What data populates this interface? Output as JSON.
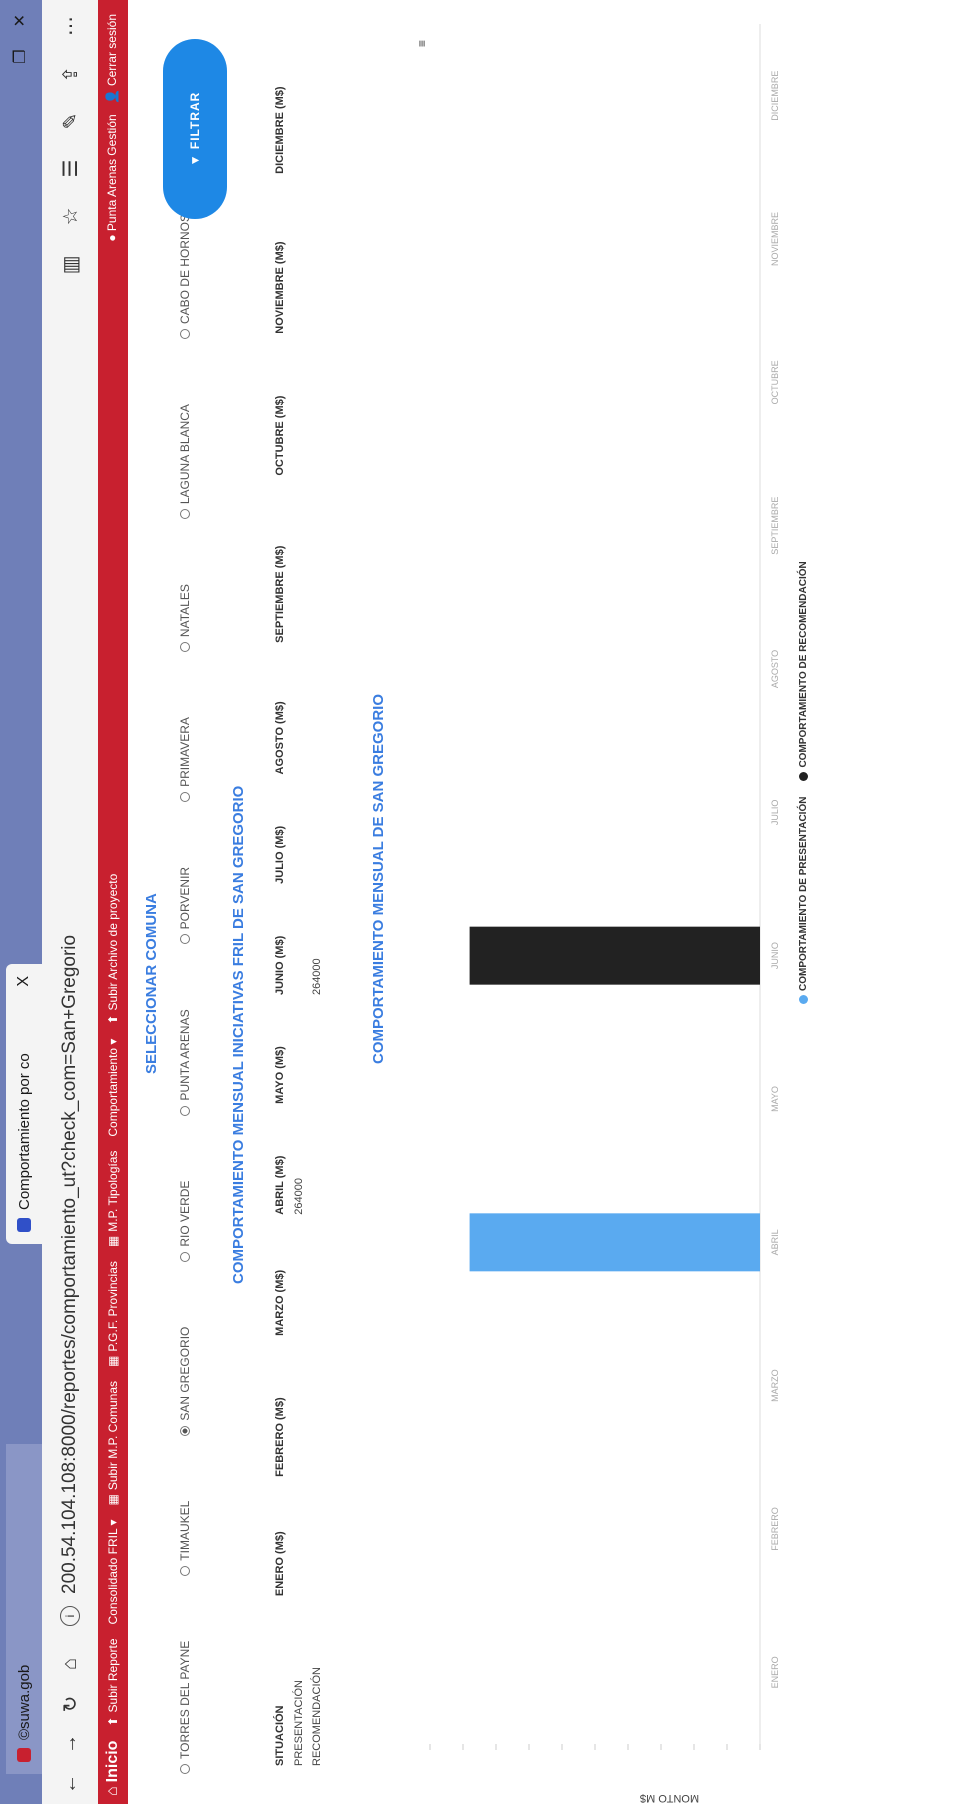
{
  "tabs": [
    {
      "label": "©suwa.gob"
    },
    {
      "label": "Comportamiento por co",
      "close": "X"
    }
  ],
  "address_bar": {
    "url": "200.54.104.108:8000/reportes/comportamiento_ut?check_com=San+Gregorio"
  },
  "app_nav": {
    "items": [
      "Inicio",
      "Subir Reporte",
      "Consolidado FRIL ▾",
      "Subir M.P. Comunas",
      "P.G.F. Provincias",
      "M.P. Tipologías",
      "Comportamiento ▾",
      "Subir Archivo de proyecto"
    ],
    "right_items": [
      "Punta Arenas Gestión",
      "Cerrar sesión"
    ]
  },
  "filters": {
    "title": "SELECCIONAR COMUNA",
    "options": [
      {
        "label": "TORRES DEL PAYNE",
        "selected": false
      },
      {
        "label": "TIMAUKEL",
        "selected": false
      },
      {
        "label": "SAN GREGORIO",
        "selected": true
      },
      {
        "label": "RIO VERDE",
        "selected": false
      },
      {
        "label": "PUNTA ARENAS",
        "selected": false
      },
      {
        "label": "PORVENIR",
        "selected": false
      },
      {
        "label": "PRIMAVERA",
        "selected": false
      },
      {
        "label": "NATALES",
        "selected": false
      },
      {
        "label": "LAGUNA BLANCA",
        "selected": false
      },
      {
        "label": "CABO DE HORNOS",
        "selected": false
      }
    ],
    "button": "FILTRAR"
  },
  "table": {
    "title": "COMPORTAMIENTO MENSUAL INICIATIVAS FRIL DE SAN GREGORIO",
    "columns": [
      "SITUACIÓN",
      "ENERO (M$)",
      "FEBRERO (M$)",
      "MARZO (M$)",
      "ABRIL (M$)",
      "MAYO (M$)",
      "JUNIO (M$)",
      "JULIO (M$)",
      "AGOSTO (M$)",
      "SEPTIEMBRE (M$)",
      "OCTUBRE (M$)",
      "NOVIEMBRE (M$)",
      "DICIEMBRE (M$)"
    ],
    "rows": [
      {
        "situacion": "PRESENTACIÓN",
        "values": [
          "",
          "",
          "",
          "264000",
          "",
          "",
          "",
          "",
          "",
          "",
          "",
          ""
        ]
      },
      {
        "situacion": "RECOMENDACIÓN",
        "values": [
          "",
          "",
          "",
          "",
          "",
          "264000",
          "",
          "",
          "",
          "",
          "",
          ""
        ]
      }
    ]
  },
  "chart_data": {
    "type": "bar",
    "title": "COMPORTAMIENTO MENSUAL DE SAN GREGORIO",
    "ylabel": "MONTO M$",
    "categories": [
      "ENERO",
      "FEBRERO",
      "MARZO",
      "ABRIL",
      "MAYO",
      "JUNIO",
      "JULIO",
      "AGOSTO",
      "SEPTIEMBRE",
      "OCTUBRE",
      "NOVIEMBRE",
      "DICIEMBRE"
    ],
    "series": [
      {
        "name": "COMPORTAMIENTO DE PRESENTACIÓN",
        "color": "#5aaaf0",
        "values": [
          0,
          0,
          0,
          264000,
          0,
          0,
          0,
          0,
          0,
          0,
          0,
          0
        ]
      },
      {
        "name": "COMPORTAMIENTO DE RECOMENDACIÓN",
        "color": "#222222",
        "values": [
          0,
          0,
          0,
          0,
          0,
          264000,
          0,
          0,
          0,
          0,
          0,
          0
        ]
      }
    ],
    "ylim": [
      0,
      300000
    ],
    "grid": false,
    "legend": "bottom"
  },
  "colors": {
    "brand_red": "#c8202f",
    "accent_blue": "#1e88e5",
    "title_blue": "#3a7de0"
  }
}
